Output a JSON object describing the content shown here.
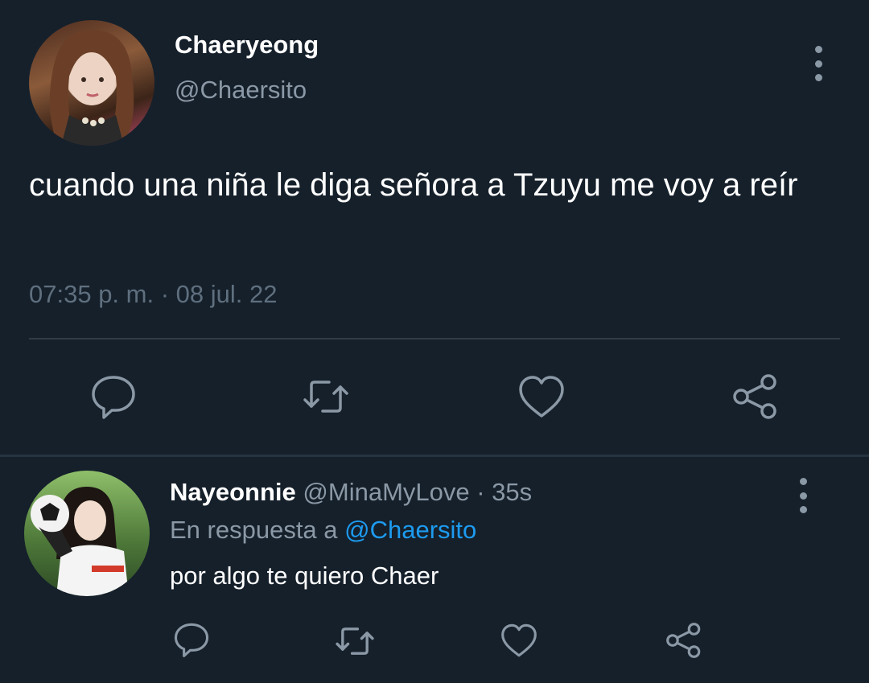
{
  "tweet": {
    "author": {
      "display_name": "Chaeryeong",
      "handle": "@Chaersito"
    },
    "text": "cuando una niña le diga señora a Tzuyu me voy a reír",
    "timestamp": "07:35 p. m. · 08 jul. 22",
    "actions": [
      "reply-icon",
      "retweet-icon",
      "like-icon",
      "share-icon"
    ]
  },
  "reply": {
    "author": {
      "display_name": "Nayeonnie",
      "handle": "@MinaMyLove",
      "time": " · 35s"
    },
    "replying_to_label": "En respuesta a ",
    "replying_to_handle": "@Chaersito",
    "text": "por algo te quiero Chaer",
    "actions": [
      "reply-icon",
      "retweet-icon",
      "like-icon",
      "share-icon"
    ]
  },
  "colors": {
    "background": "#15202b",
    "secondary_text": "#8b98a5",
    "accent": "#1d9bf0"
  }
}
